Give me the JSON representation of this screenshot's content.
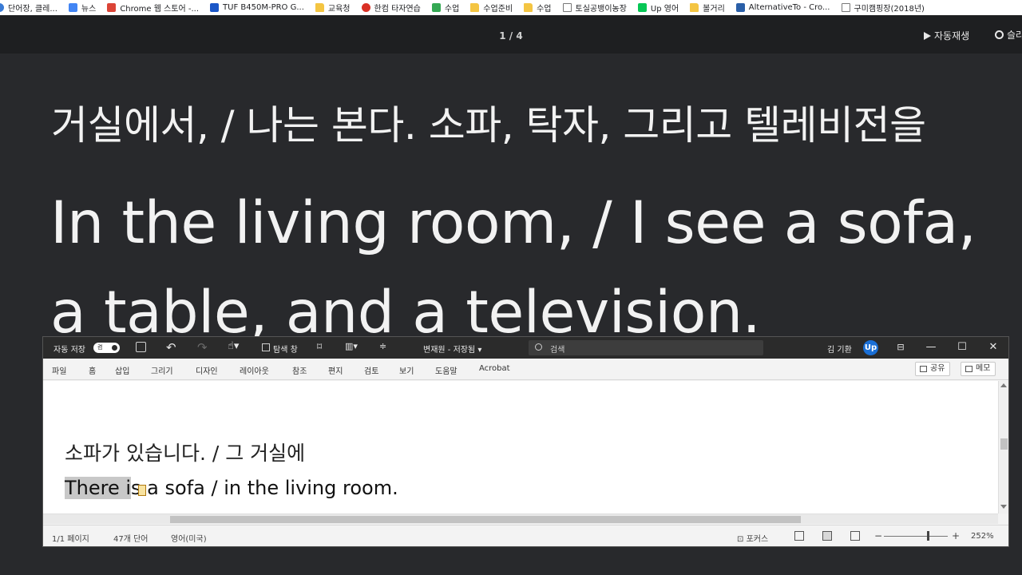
{
  "bookmarks": [
    {
      "label": "단어장, 클레...",
      "icon": "dictionary-icon",
      "color": "#3a7bd5"
    },
    {
      "label": "뉴스",
      "icon": "news-icon",
      "color": "#4285f4"
    },
    {
      "label": "Chrome 웹 스토어 -...",
      "icon": "chrome-store-icon",
      "color": "#db4437"
    },
    {
      "label": "TUF B450M-PRO G...",
      "icon": "asus-icon",
      "color": "#1a56c7"
    },
    {
      "label": "교육청",
      "icon": "folder-icon",
      "color": "#f4c542"
    },
    {
      "label": "한컴 타자연습",
      "icon": "hancom-icon",
      "color": "#d93025"
    },
    {
      "label": "수업",
      "icon": "photo-icon",
      "color": "#34a853"
    },
    {
      "label": "수업준비",
      "icon": "folder-icon",
      "color": "#f4c542"
    },
    {
      "label": "수업",
      "icon": "folder-icon",
      "color": "#f4c542"
    },
    {
      "label": "토실공뱅이농장",
      "icon": "page-icon",
      "color": "#ffffff"
    },
    {
      "label": "Up 영어",
      "icon": "line-icon",
      "color": "#06c755"
    },
    {
      "label": "볼거리",
      "icon": "folder-icon",
      "color": "#f4c542"
    },
    {
      "label": "AlternativeTo - Cro...",
      "icon": "alternativeto-icon",
      "color": "#2a5fa8"
    },
    {
      "label": "구미캠핑장(2018년)",
      "icon": "page-icon",
      "color": "#ffffff"
    }
  ],
  "viewer": {
    "page_counter": "1 / 4",
    "autoplay_label": "자동재생",
    "settings_label": "슬라"
  },
  "slide": {
    "korean": "거실에서, / 나는 본다. 소파, 탁자, 그리고 텔레비전을",
    "english_line1": "In the living room, / I see a sofa,",
    "english_line2": "a table, and a television."
  },
  "word": {
    "autosave_label": "자동 저장",
    "autosave_state": "켬",
    "nav_pane_label": "탐색 창",
    "doc_title": "변재원 - 저장됨",
    "search_placeholder": "검색",
    "user_name": "김 기환",
    "avatar_text": "Up",
    "tabs": [
      "파일",
      "홈",
      "삽입",
      "그리기",
      "디자인",
      "레이아웃",
      "참조",
      "편지",
      "검토",
      "보기",
      "도움말",
      "Acrobat"
    ],
    "share_label": "공유",
    "memo_label": "메모",
    "doc_korean": "소파가  있습니다. /  그  거실에",
    "doc_english_selected": "There i",
    "doc_english_rest": "s a sofa / in the living room.",
    "status_page": "1/1 페이지",
    "status_words": "47개 단어",
    "status_language": "영어(미국)",
    "focus_label": "포커스",
    "zoom_minus": "−",
    "zoom_plus": "+",
    "zoom_level": "252%"
  }
}
